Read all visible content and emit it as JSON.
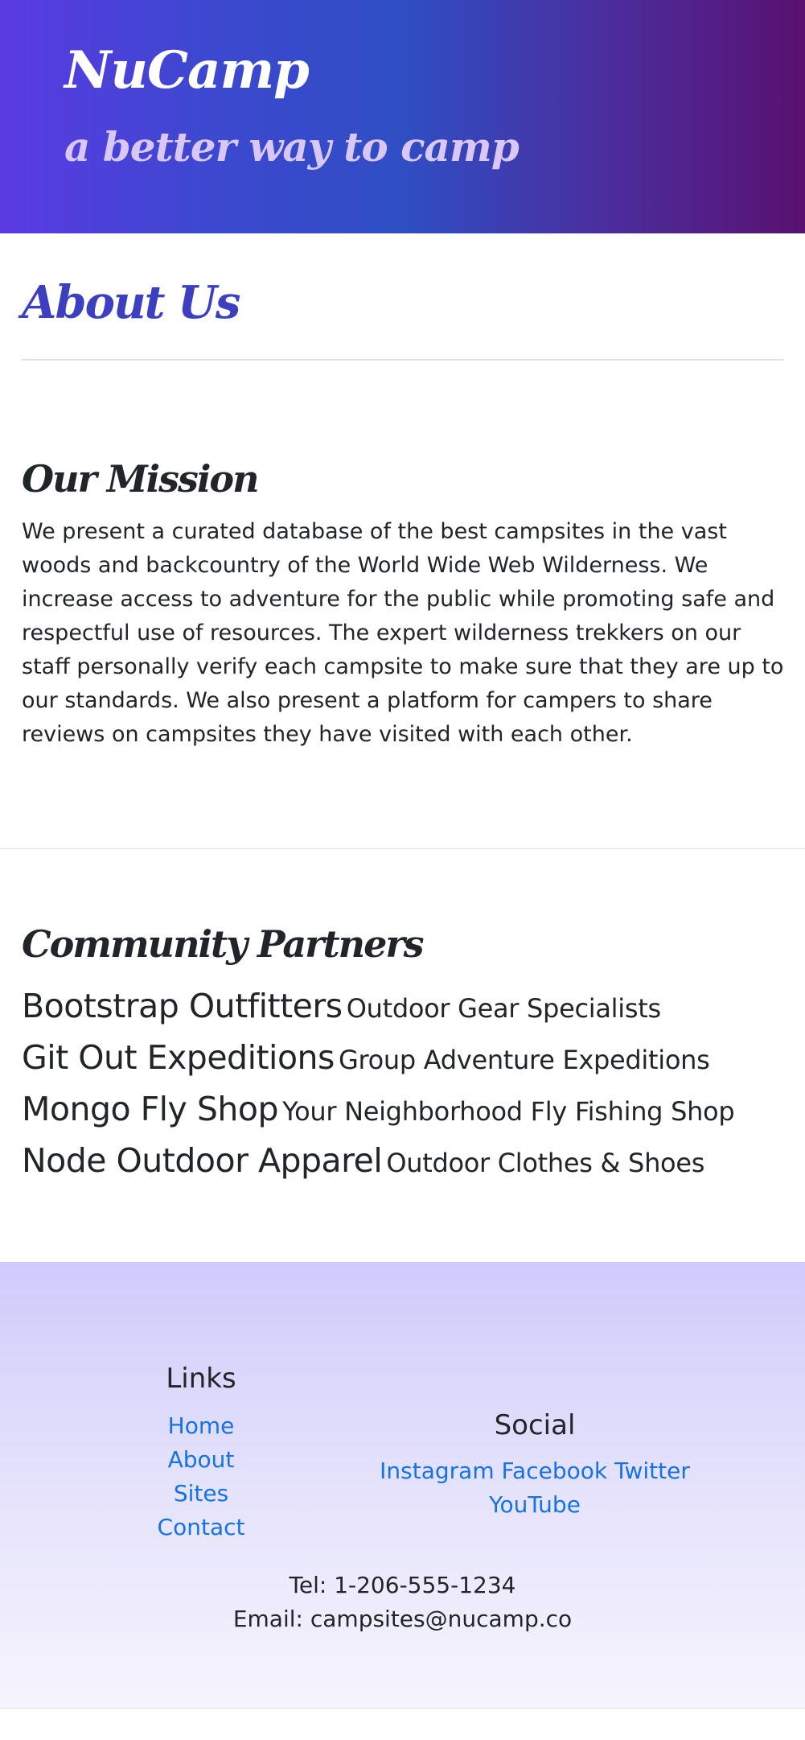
{
  "header": {
    "brand": "NuCamp",
    "tagline": "a better way to camp"
  },
  "page": {
    "title": "About Us"
  },
  "mission": {
    "heading": "Our Mission",
    "text": "We present a curated database of the best campsites in the vast woods and backcountry of the World Wide Web Wilderness. We increase access to adventure for the public while promoting safe and respectful use of resources. The expert wilderness trekkers on our staff personally verify each campsite to make sure that they are up to our standards. We also present a platform for campers to share reviews on campsites they have visited with each other."
  },
  "partners": {
    "heading": "Community Partners",
    "items": [
      {
        "name": "Bootstrap Outfitters",
        "description": "Outdoor Gear Specialists"
      },
      {
        "name": "Git Out Expeditions",
        "description": "Group Adventure Expeditions"
      },
      {
        "name": "Mongo Fly Shop",
        "description": "Your Neighborhood Fly Fishing Shop"
      },
      {
        "name": "Node Outdoor Apparel",
        "description": "Outdoor Clothes & Shoes"
      }
    ]
  },
  "footer": {
    "links_title": "Links",
    "links": [
      "Home",
      "About",
      "Sites",
      "Contact"
    ],
    "social_title": "Social",
    "social": [
      "Instagram",
      "Facebook",
      "Twitter",
      "YouTube"
    ],
    "tel": "Tel: 1-206-555-1234",
    "email": "Email: campsites@nucamp.co"
  },
  "colors": {
    "brand_gradient_start": "#5b3ae3",
    "brand_gradient_end": "#5a1170",
    "title_blue": "#3b3fc0",
    "link_blue": "#1473e6",
    "footer_bg": "#d0cbfb"
  }
}
